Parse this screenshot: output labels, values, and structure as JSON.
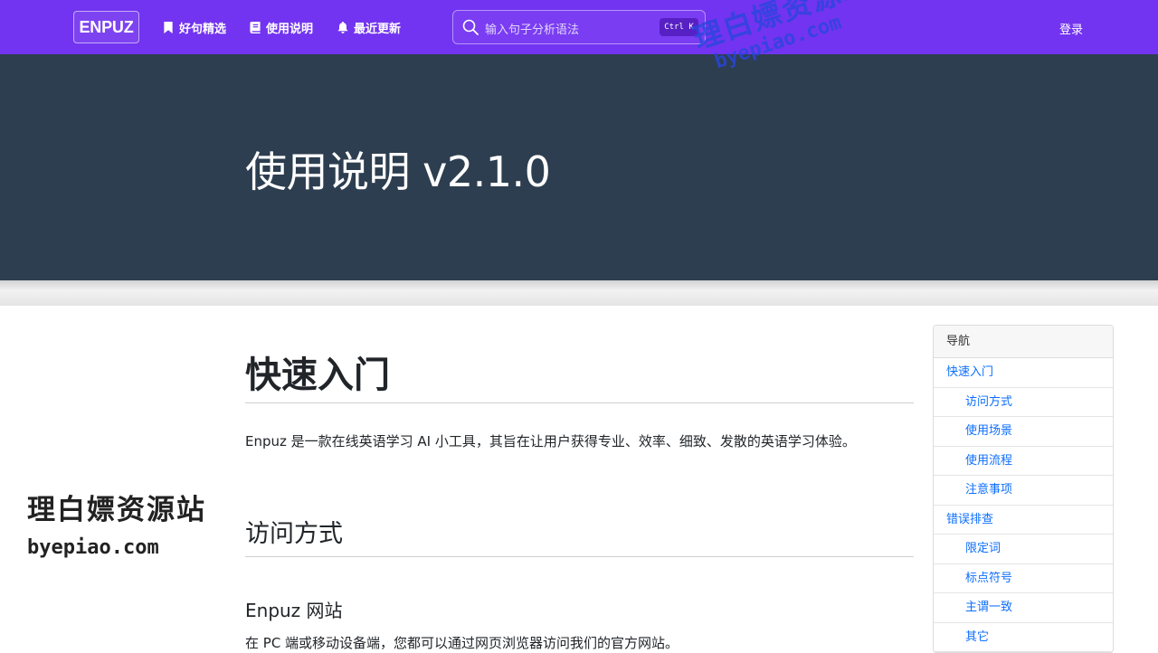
{
  "navbar": {
    "brand": "ENPUZ",
    "links": [
      {
        "label": "好句精选",
        "icon": "bookmark-icon"
      },
      {
        "label": "使用说明",
        "icon": "book-icon"
      },
      {
        "label": "最近更新",
        "icon": "bell-icon"
      }
    ],
    "search": {
      "placeholder": "输入句子分析语法",
      "shortcut": "Ctrl K",
      "icon": "search-icon"
    },
    "login": "登录"
  },
  "hero": {
    "title": "使用说明 v2.1.0"
  },
  "content": {
    "h_quickstart": "快速入门",
    "intro": "Enpuz 是一款在线英语学习 AI 小工具，其旨在让用户获得专业、效率、细致、发散的英语学习体验。",
    "h_access": "访问方式",
    "h_website": "Enpuz 网站",
    "p_website": "在 PC 端或移动设备端，您都可以通过网页浏览器访问我们的官方网站。"
  },
  "toc": {
    "title": "导航",
    "items": [
      {
        "label": "快速入门",
        "level": 1
      },
      {
        "label": "访问方式",
        "level": 2
      },
      {
        "label": "使用场景",
        "level": 2
      },
      {
        "label": "使用流程",
        "level": 2
      },
      {
        "label": "注意事项",
        "level": 2
      },
      {
        "label": "错误排查",
        "level": 1
      },
      {
        "label": "限定词",
        "level": 2
      },
      {
        "label": "标点符号",
        "level": 2
      },
      {
        "label": "主谓一致",
        "level": 2
      },
      {
        "label": "其它",
        "level": 2
      }
    ]
  },
  "watermark": {
    "cn": "理白嫖资源站",
    "url": "byepiao.com"
  },
  "colors": {
    "navbar": "#7234f0",
    "hero": "#2d3e50",
    "link": "#0d6efd"
  }
}
